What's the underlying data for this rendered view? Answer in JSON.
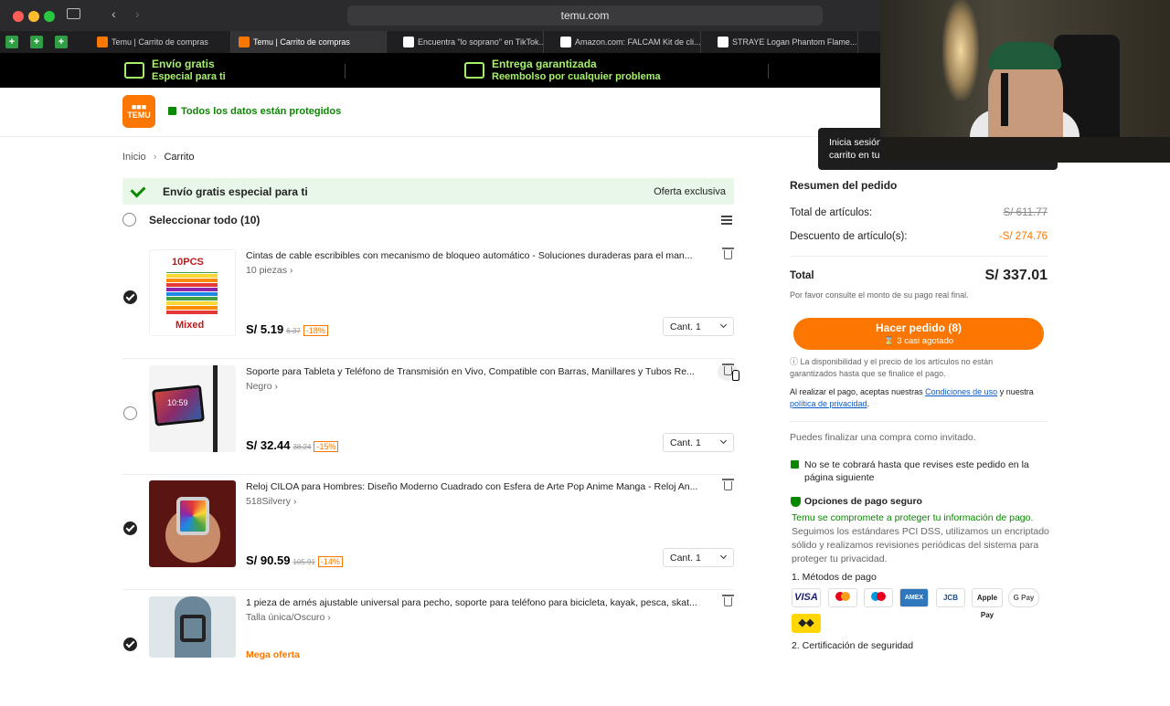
{
  "browser": {
    "url": "temu.com",
    "tabs": [
      {
        "label": "Temu | Carrito de compras"
      },
      {
        "label": "Temu | Carrito de compras"
      },
      {
        "label": "Encuentra \"lo soprano\" en TikTok..."
      },
      {
        "label": "Amazon.com: FALCAM Kit de cli..."
      },
      {
        "label": "STRAYE Logan Phantom Flame..."
      }
    ]
  },
  "promo": {
    "free_shipping_title": "Envío gratis",
    "free_shipping_sub": "Especial para ti",
    "guaranteed_title": "Entrega garantizada",
    "guaranteed_sub": "Reembolso por cualquier problema"
  },
  "header": {
    "logo": "TEMU",
    "secure_text": "Todos los datos están protegidos"
  },
  "breadcrumb": {
    "home": "Inicio",
    "current": "Carrito"
  },
  "banner": {
    "text": "Envío gratis especial para ti",
    "right": "Oferta exclusiva"
  },
  "select_all": "Seleccionar todo (10)",
  "items": [
    {
      "title": "Cintas de cable escribibles con mecanismo de bloqueo automático - Soluciones duraderas para el man...",
      "variant": "10 piezas",
      "price": "S/ 5.19",
      "old_price": "6.37",
      "discount": "-18%",
      "qty": "Cant. 1",
      "checked": true,
      "thumb_top": "10PCS",
      "thumb_bottom": "Mixed"
    },
    {
      "title": "Soporte para Tableta y Teléfono de Transmisión en Vivo, Compatible con Barras, Manillares y Tubos Re...",
      "variant": "Negro",
      "price": "S/ 32.44",
      "old_price": "38.24",
      "discount": "-15%",
      "qty": "Cant. 1",
      "checked": false,
      "thumb_time": "10:59"
    },
    {
      "title": "Reloj CILOA para Hombres: Diseño Moderno Cuadrado con Esfera de Arte Pop Anime Manga - Reloj An...",
      "variant": "518Silvery",
      "price": "S/ 90.59",
      "old_price": "105.91",
      "discount": "-14%",
      "qty": "Cant. 1",
      "checked": true
    },
    {
      "title": "1 pieza de arnés ajustable universal para pecho, soporte para teléfono para bicicleta, kayak, pesca, skat...",
      "variant": "Talla única/Oscuro",
      "tag": "Mega oferta",
      "checked": true
    }
  ],
  "summary": {
    "title": "Resumen del pedido",
    "items_total_label": "Total de artículos:",
    "items_total_value": "S/ 611.77",
    "discount_label": "Descuento de artículo(s):",
    "discount_value": "-S/ 274.76",
    "total_label": "Total",
    "total_value": "S/ 337.01",
    "consult_note": "Por favor consulte el monto de su pago real final.",
    "order_button": "Hacer pedido (8)",
    "order_sub": "3 casi agotado",
    "availability_note": "La disponibilidad y el precio de los artículos no están garantizados hasta que se finalice el pago.",
    "terms_prefix": "Al realizar el pago, aceptas nuestras",
    "terms_link": "Condiciones de uso",
    "terms_mid": "y nuestra",
    "privacy_link": "política de privacidad",
    "guest_text": "Puedes finalizar una compra como invitado.",
    "no_charge": "No se te cobrará hasta que revises este pedido en la página siguiente",
    "secure_pay_title": "Opciones de pago seguro",
    "secure_pay_green": "Temu se compromete a proteger tu información de pago.",
    "secure_pay_gray": "Seguimos los estándares PCI DSS, utilizamos un encriptado sólido y realizamos revisiones periódicas del sistema para proteger tu privacidad.",
    "methods_title": "1. Métodos de pago",
    "cert_title": "2. Certificación de seguridad",
    "methods": [
      "VISA",
      "MC",
      "Maestro",
      "AMEX",
      "JCB",
      "Apple Pay",
      "G Pay"
    ]
  },
  "tooltip": {
    "line1": "Inicia sesión",
    "line2": "carrito en tu"
  },
  "colors": {
    "accent": "#fb7701",
    "green": "#0a8800",
    "promo_green": "#a6f06a"
  }
}
